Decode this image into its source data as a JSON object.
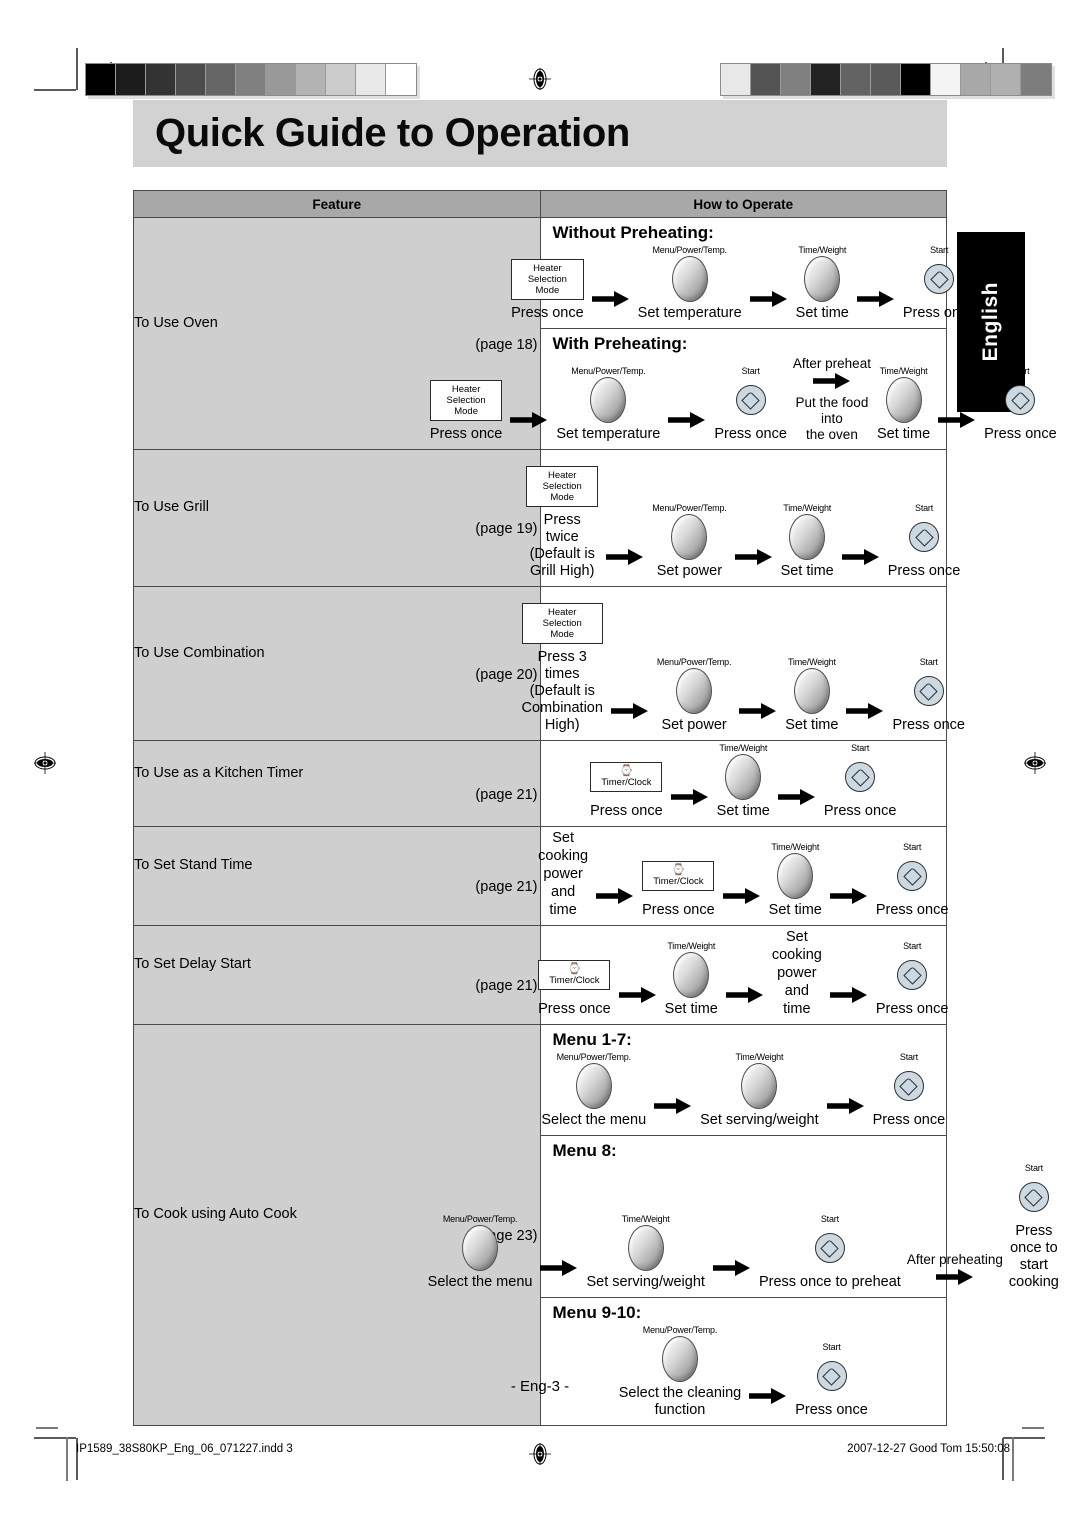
{
  "document": {
    "title": "Quick Guide to Operation",
    "language_tab": "English",
    "page_number": "- Eng-3 -",
    "footer_left": "IP1589_38S80KP_Eng_06_071227.indd   3",
    "footer_right": "2007-12-27   Good Tom 15:50:08"
  },
  "colors": {
    "banner": "#d2d2d2",
    "header_row": "#a8a8a8",
    "feature_cell": "#cfcfcf",
    "tab_background": "#000000",
    "start_button": "#ccd9e2",
    "border": "#4a4a4a"
  },
  "calibration": {
    "left_bar": [
      "#000000",
      "#1c1c1c",
      "#333333",
      "#4d4d4d",
      "#666666",
      "#808080",
      "#999999",
      "#b3b3b3",
      "#cccccc",
      "#e8e8e8",
      "#ffffff"
    ],
    "right_bar": [
      "#e8e8e8",
      "#545454",
      "#808080",
      "#222222",
      "#636363",
      "#5a5a5a",
      "#000000",
      "#f4f4f4",
      "#a8a8a8",
      "#b0b0b0",
      "#7d7d7d"
    ]
  },
  "table": {
    "headers": {
      "feature": "Feature",
      "how_to_operate": "How to Operate"
    },
    "rows": [
      {
        "feature": "To Use Oven",
        "page": "(page  18)",
        "blocks": [
          {
            "title": "Without Preheating:",
            "steps": [
              {
                "kind": "pad",
                "pad_line1": "Heater",
                "pad_line2": "Selection Mode",
                "caption": "Press once"
              },
              {
                "kind": "arrow"
              },
              {
                "kind": "knob",
                "control_label": "Menu/Power/Temp.",
                "caption": "Set temperature"
              },
              {
                "kind": "arrow"
              },
              {
                "kind": "knob",
                "control_label": "Time/Weight",
                "caption": "Set time"
              },
              {
                "kind": "arrow"
              },
              {
                "kind": "start",
                "control_label": "Start",
                "caption": "Press once"
              }
            ]
          },
          {
            "title": "With Preheating:",
            "steps": [
              {
                "kind": "pad",
                "pad_line1": "Heater",
                "pad_line2": "Selection Mode",
                "caption": "Press once"
              },
              {
                "kind": "arrow"
              },
              {
                "kind": "knob",
                "control_label": "Menu/Power/Temp.",
                "caption": "Set temperature"
              },
              {
                "kind": "arrow"
              },
              {
                "kind": "start",
                "control_label": "Start",
                "caption": "Press once"
              },
              {
                "kind": "arrow-text",
                "above": "After preheat",
                "below": "Put the food into\nthe oven"
              },
              {
                "kind": "knob",
                "control_label": "Time/Weight",
                "caption": "Set time"
              },
              {
                "kind": "arrow"
              },
              {
                "kind": "start",
                "control_label": "Start",
                "caption": "Press once"
              }
            ]
          }
        ]
      },
      {
        "feature": "To Use Grill",
        "page": "(page  19)",
        "blocks": [
          {
            "title": "",
            "steps": [
              {
                "kind": "pad",
                "pad_line1": "Heater",
                "pad_line2": "Selection Mode",
                "caption": "Press twice\n(Default is Grill High)"
              },
              {
                "kind": "arrow"
              },
              {
                "kind": "knob",
                "control_label": "Menu/Power/Temp.",
                "caption": "Set power"
              },
              {
                "kind": "arrow"
              },
              {
                "kind": "knob",
                "control_label": "Time/Weight",
                "caption": "Set time"
              },
              {
                "kind": "arrow"
              },
              {
                "kind": "start",
                "control_label": "Start",
                "caption": "Press once"
              }
            ]
          }
        ]
      },
      {
        "feature": "To Use Combination",
        "page": "(page 20)",
        "blocks": [
          {
            "title": "",
            "steps": [
              {
                "kind": "pad",
                "pad_line1": "Heater",
                "pad_line2": "Selection Mode",
                "caption": "Press 3 times\n(Default is Combination High)"
              },
              {
                "kind": "arrow"
              },
              {
                "kind": "knob",
                "control_label": "Menu/Power/Temp.",
                "caption": "Set power"
              },
              {
                "kind": "arrow"
              },
              {
                "kind": "knob",
                "control_label": "Time/Weight",
                "caption": "Set time"
              },
              {
                "kind": "arrow"
              },
              {
                "kind": "start",
                "control_label": "Start",
                "caption": "Press once"
              }
            ]
          }
        ]
      },
      {
        "feature": "To Use as a Kitchen Timer",
        "page": "(page 21)",
        "blocks": [
          {
            "title": "",
            "steps": [
              {
                "kind": "pad",
                "pad_glyph": "⌚",
                "pad_line2": "Timer/Clock",
                "caption": "Press once"
              },
              {
                "kind": "arrow"
              },
              {
                "kind": "knob",
                "control_label": "Time/Weight",
                "caption": "Set time"
              },
              {
                "kind": "arrow"
              },
              {
                "kind": "start",
                "control_label": "Start",
                "caption": "Press once"
              }
            ]
          }
        ]
      },
      {
        "feature": "To Set Stand Time",
        "page": "(page 21)",
        "blocks": [
          {
            "title": "",
            "steps": [
              {
                "kind": "text",
                "text": "Set cooking\npower and time"
              },
              {
                "kind": "arrow"
              },
              {
                "kind": "pad",
                "pad_glyph": "⌚",
                "pad_line2": "Timer/Clock",
                "caption": "Press once"
              },
              {
                "kind": "arrow"
              },
              {
                "kind": "knob",
                "control_label": "Time/Weight",
                "caption": "Set time"
              },
              {
                "kind": "arrow"
              },
              {
                "kind": "start",
                "control_label": "Start",
                "caption": "Press once"
              }
            ]
          }
        ]
      },
      {
        "feature": "To Set Delay Start",
        "page": "(page 21)",
        "blocks": [
          {
            "title": "",
            "steps": [
              {
                "kind": "pad",
                "pad_glyph": "⌚",
                "pad_line2": "Timer/Clock",
                "caption": "Press once"
              },
              {
                "kind": "arrow"
              },
              {
                "kind": "knob",
                "control_label": "Time/Weight",
                "caption": "Set time"
              },
              {
                "kind": "arrow"
              },
              {
                "kind": "text",
                "text": "Set cooking\npower and time"
              },
              {
                "kind": "arrow"
              },
              {
                "kind": "start",
                "control_label": "Start",
                "caption": "Press once"
              }
            ]
          }
        ]
      },
      {
        "feature": "To Cook using Auto Cook",
        "page": "(page 23)",
        "blocks": [
          {
            "title": "Menu 1-7:",
            "steps": [
              {
                "kind": "knob",
                "control_label": "Menu/Power/Temp.",
                "caption": "Select the menu"
              },
              {
                "kind": "arrow"
              },
              {
                "kind": "knob",
                "control_label": "Time/Weight",
                "caption": "Set serving/weight"
              },
              {
                "kind": "arrow"
              },
              {
                "kind": "start",
                "control_label": "Start",
                "caption": "Press once"
              }
            ]
          },
          {
            "title": "Menu 8:",
            "steps": [
              {
                "kind": "knob",
                "control_label": "Menu/Power/Temp.",
                "caption": "Select the menu"
              },
              {
                "kind": "arrow"
              },
              {
                "kind": "knob",
                "control_label": "Time/Weight",
                "caption": "Set serving/weight"
              },
              {
                "kind": "arrow"
              },
              {
                "kind": "start",
                "control_label": "Start",
                "caption": "Press once to preheat"
              },
              {
                "kind": "arrow-text",
                "above": "After preheating",
                "below": ""
              },
              {
                "kind": "start",
                "control_label": "Start",
                "caption": "Press once to\nstart cooking"
              }
            ]
          },
          {
            "title": "Menu 9-10:",
            "steps": [
              {
                "kind": "knob",
                "control_label": "Menu/Power/Temp.",
                "caption": "Select the cleaning\nfunction"
              },
              {
                "kind": "arrow"
              },
              {
                "kind": "start",
                "control_label": "Start",
                "caption": "Press once"
              }
            ]
          }
        ]
      }
    ]
  }
}
